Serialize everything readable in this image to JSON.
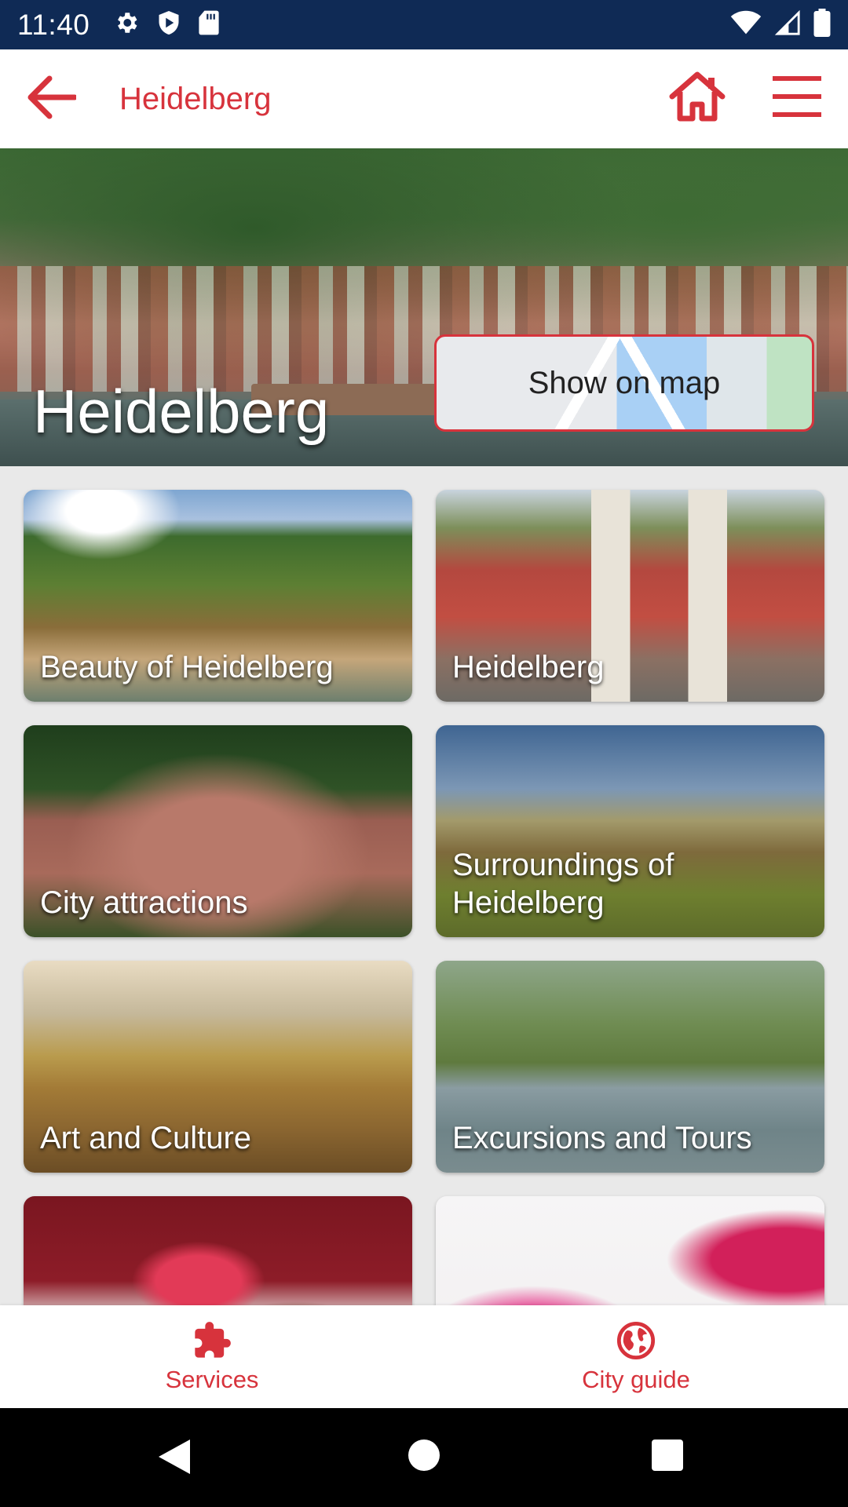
{
  "status_bar": {
    "time": "11:40",
    "left_icons": [
      "settings-gear-icon",
      "shield-icon",
      "sd-card-icon"
    ],
    "right_icons": [
      "wifi-icon",
      "cellular-signal-icon",
      "battery-icon"
    ]
  },
  "app_bar": {
    "title": "Heidelberg",
    "accent_color": "#d7333c",
    "icons": [
      "back-arrow-icon",
      "home-icon",
      "hamburger-menu-icon"
    ]
  },
  "hero": {
    "title": "Heidelberg",
    "map_button_label": "Show on map"
  },
  "tiles": [
    {
      "label": "Beauty of Heidelberg"
    },
    {
      "label": "Heidelberg"
    },
    {
      "label": "City attractions"
    },
    {
      "label": "Surroundings of Heidelberg"
    },
    {
      "label": "Art and Culture"
    },
    {
      "label": "Excursions and Tours"
    },
    {
      "label": ""
    },
    {
      "label": ""
    }
  ],
  "bottom_nav": {
    "items": [
      {
        "label": "Services",
        "icon": "puzzle-icon"
      },
      {
        "label": "City guide",
        "icon": "globe-icon"
      }
    ]
  },
  "system_nav": {
    "buttons": [
      "back-triangle-icon",
      "home-circle-icon",
      "recents-square-icon"
    ]
  }
}
